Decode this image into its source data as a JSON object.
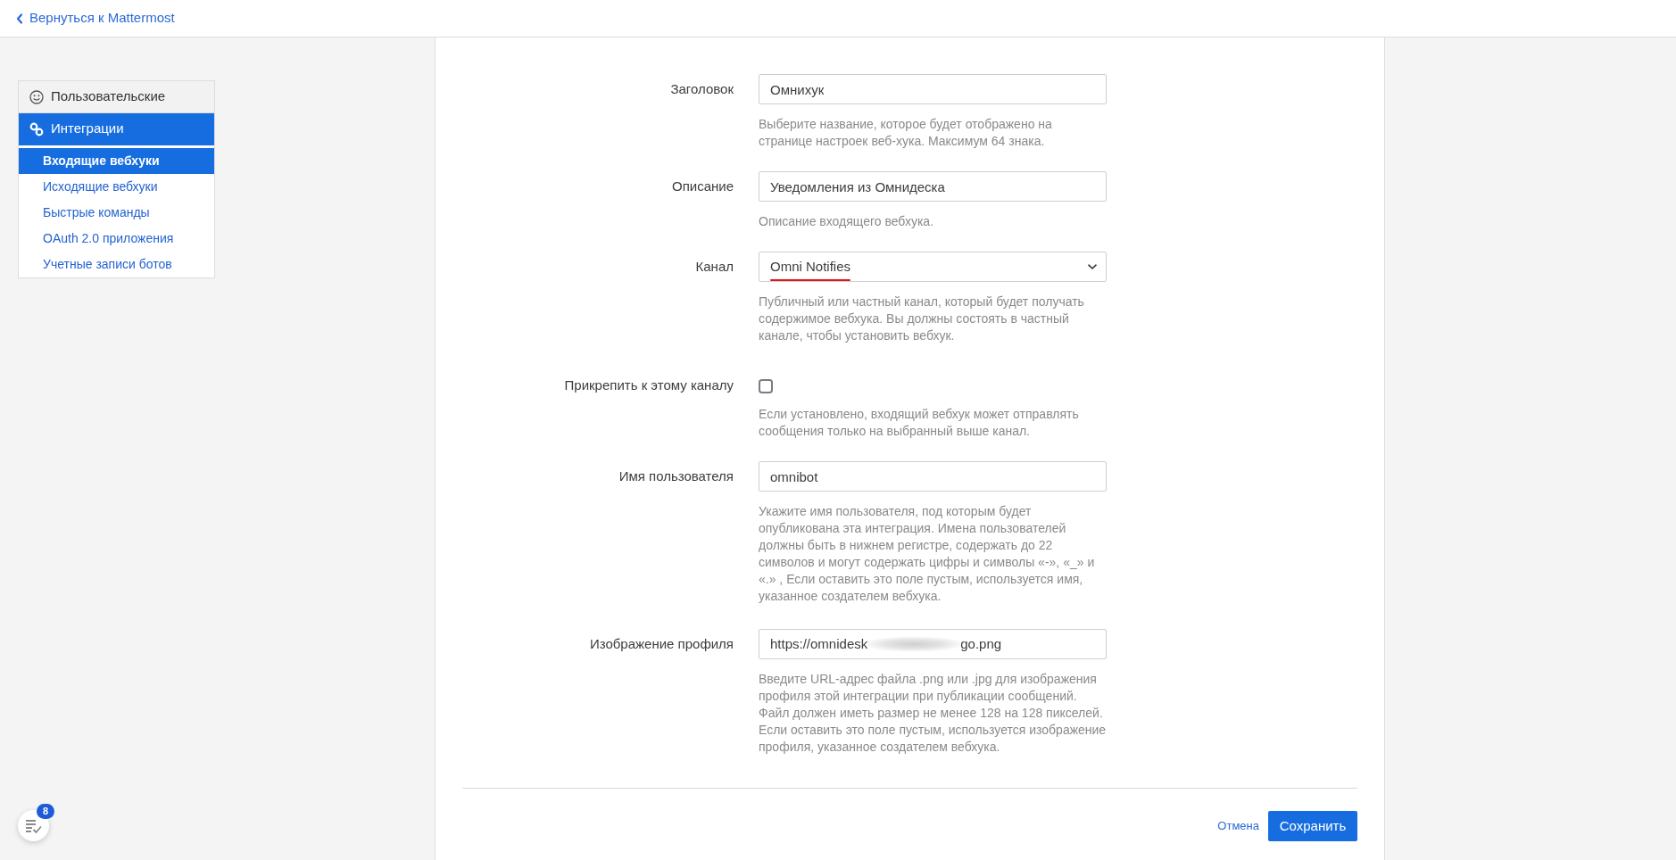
{
  "header": {
    "back_link": "Вернуться к Mattermost"
  },
  "sidebar": {
    "sections": [
      {
        "label": "Пользовательские",
        "selected": false
      },
      {
        "label": "Интеграции",
        "selected": true,
        "items": [
          {
            "label": "Входящие вебхуки",
            "selected": true
          },
          {
            "label": "Исходящие вебхуки",
            "selected": false
          },
          {
            "label": "Быстрые команды",
            "selected": false
          },
          {
            "label": "OAuth 2.0 приложения",
            "selected": false
          },
          {
            "label": "Учетные записи ботов",
            "selected": false
          }
        ]
      }
    ]
  },
  "form": {
    "fields": [
      {
        "kind": "text",
        "label": "Заголовок",
        "value": "Омнихук",
        "help": "Выберите название, которое будет отображено на странице настроек веб-хука. Максимум 64 знака."
      },
      {
        "kind": "text",
        "label": "Описание",
        "value": "Уведомления из Омнидеска",
        "help": "Описание входящего вебхука."
      },
      {
        "kind": "select",
        "label": "Канал",
        "value": "Omni Notifies",
        "underlined": true,
        "help": "Публичный или частный канал, который будет получать содержимое вебхука. Вы должны состоять в частный канале, чтобы установить вебхук."
      },
      {
        "kind": "checkbox",
        "label": "Прикрепить к этому каналу",
        "checked": false,
        "help": "Если установлено, входящий вебхук может отправлять сообщения только на выбранный выше канал."
      },
      {
        "kind": "text",
        "label": "Имя пользователя",
        "value": "omnibot",
        "help": "Укажите имя пользователя, под которым будет опубликована эта интеграция. Имена пользователей должны быть в нижнем регистре, содержать до 22 символов и могут содержать цифры и символы «-», «_» и «.» , Если оставить это поле пустым, используется имя, указанное создателем вебхука."
      },
      {
        "kind": "redacted",
        "label": "Изображение профиля",
        "visible_parts": [
          "https://omnidesk",
          "go.png"
        ],
        "help": "Введите URL-адрес файла .png или .jpg для изображения профиля этой интеграции при публикации сообщений. Файл должен иметь размер не менее 128 на 128 пикселей. Если оставить это поле пустым, используется изображение профиля, указанное создателем вебхука."
      }
    ]
  },
  "actions": {
    "cancel": "Отмена",
    "save": "Сохранить"
  },
  "floating_button": {
    "badge": "8"
  }
}
